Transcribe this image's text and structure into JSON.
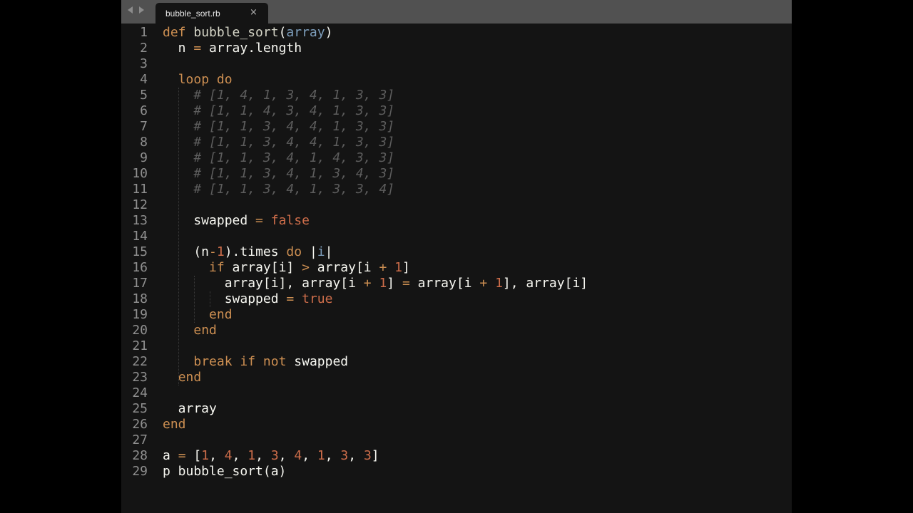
{
  "window": {
    "tabs": [
      {
        "label": "bubble_sort.rb",
        "close_icon": "×",
        "active": true
      }
    ],
    "nav_icons": [
      "back-arrow-icon",
      "forward-arrow-icon"
    ]
  },
  "editor": {
    "language": "ruby",
    "lines": [
      {
        "n": "1",
        "tokens": [
          [
            "k",
            "def"
          ],
          [
            "t",
            " "
          ],
          [
            "fn",
            "bubble_sort"
          ],
          [
            "t",
            "("
          ],
          [
            "pa",
            "array"
          ],
          [
            "t",
            ")"
          ]
        ]
      },
      {
        "n": "2",
        "tokens": [
          [
            "t",
            "  n "
          ],
          [
            "op",
            "="
          ],
          [
            "t",
            " array.length"
          ]
        ]
      },
      {
        "n": "3",
        "tokens": []
      },
      {
        "n": "4",
        "tokens": [
          [
            "t",
            "  "
          ],
          [
            "k",
            "loop"
          ],
          [
            "t",
            " "
          ],
          [
            "k",
            "do"
          ]
        ]
      },
      {
        "n": "5",
        "tokens": [
          [
            "t",
            "    "
          ],
          [
            "c",
            "# [1, 4, 1, 3, 4, 1, 3, 3]"
          ]
        ]
      },
      {
        "n": "6",
        "tokens": [
          [
            "t",
            "    "
          ],
          [
            "c",
            "# [1, 1, 4, 3, 4, 1, 3, 3]"
          ]
        ]
      },
      {
        "n": "7",
        "tokens": [
          [
            "t",
            "    "
          ],
          [
            "c",
            "# [1, 1, 3, 4, 4, 1, 3, 3]"
          ]
        ]
      },
      {
        "n": "8",
        "tokens": [
          [
            "t",
            "    "
          ],
          [
            "c",
            "# [1, 1, 3, 4, 4, 1, 3, 3]"
          ]
        ]
      },
      {
        "n": "9",
        "tokens": [
          [
            "t",
            "    "
          ],
          [
            "c",
            "# [1, 1, 3, 4, 1, 4, 3, 3]"
          ]
        ]
      },
      {
        "n": "10",
        "tokens": [
          [
            "t",
            "    "
          ],
          [
            "c",
            "# [1, 1, 3, 4, 1, 3, 4, 3]"
          ]
        ]
      },
      {
        "n": "11",
        "tokens": [
          [
            "t",
            "    "
          ],
          [
            "c",
            "# [1, 1, 3, 4, 1, 3, 3, 4]"
          ]
        ]
      },
      {
        "n": "12",
        "tokens": []
      },
      {
        "n": "13",
        "tokens": [
          [
            "t",
            "    swapped "
          ],
          [
            "op",
            "="
          ],
          [
            "t",
            " "
          ],
          [
            "b",
            "false"
          ]
        ]
      },
      {
        "n": "14",
        "tokens": []
      },
      {
        "n": "15",
        "tokens": [
          [
            "t",
            "    (n"
          ],
          [
            "op",
            "-"
          ],
          [
            "n",
            "1"
          ],
          [
            "t",
            ").times "
          ],
          [
            "k",
            "do"
          ],
          [
            "t",
            " |"
          ],
          [
            "pa",
            "i"
          ],
          [
            "t",
            "|"
          ]
        ]
      },
      {
        "n": "16",
        "tokens": [
          [
            "t",
            "      "
          ],
          [
            "k",
            "if"
          ],
          [
            "t",
            " array[i] "
          ],
          [
            "op",
            ">"
          ],
          [
            "t",
            " array[i "
          ],
          [
            "op",
            "+"
          ],
          [
            "t",
            " "
          ],
          [
            "n",
            "1"
          ],
          [
            "t",
            "]"
          ]
        ]
      },
      {
        "n": "17",
        "tokens": [
          [
            "t",
            "        array[i], array[i "
          ],
          [
            "op",
            "+"
          ],
          [
            "t",
            " "
          ],
          [
            "n",
            "1"
          ],
          [
            "t",
            "] "
          ],
          [
            "op",
            "="
          ],
          [
            "t",
            " array[i "
          ],
          [
            "op",
            "+"
          ],
          [
            "t",
            " "
          ],
          [
            "n",
            "1"
          ],
          [
            "t",
            "], array[i]"
          ]
        ]
      },
      {
        "n": "18",
        "tokens": [
          [
            "t",
            "        swapped "
          ],
          [
            "op",
            "="
          ],
          [
            "t",
            " "
          ],
          [
            "b",
            "true"
          ]
        ]
      },
      {
        "n": "19",
        "tokens": [
          [
            "t",
            "      "
          ],
          [
            "k",
            "end"
          ]
        ]
      },
      {
        "n": "20",
        "tokens": [
          [
            "t",
            "    "
          ],
          [
            "k",
            "end"
          ]
        ]
      },
      {
        "n": "21",
        "tokens": []
      },
      {
        "n": "22",
        "tokens": [
          [
            "t",
            "    "
          ],
          [
            "k",
            "break"
          ],
          [
            "t",
            " "
          ],
          [
            "k",
            "if"
          ],
          [
            "t",
            " "
          ],
          [
            "k",
            "not"
          ],
          [
            "t",
            " swapped"
          ]
        ]
      },
      {
        "n": "23",
        "tokens": [
          [
            "t",
            "  "
          ],
          [
            "k",
            "end"
          ]
        ]
      },
      {
        "n": "24",
        "tokens": []
      },
      {
        "n": "25",
        "tokens": [
          [
            "t",
            "  array"
          ]
        ]
      },
      {
        "n": "26",
        "tokens": [
          [
            "k",
            "end"
          ]
        ]
      },
      {
        "n": "27",
        "tokens": []
      },
      {
        "n": "28",
        "tokens": [
          [
            "t",
            "a "
          ],
          [
            "op",
            "="
          ],
          [
            "t",
            " ["
          ],
          [
            "n",
            "1"
          ],
          [
            "t",
            ", "
          ],
          [
            "n",
            "4"
          ],
          [
            "t",
            ", "
          ],
          [
            "n",
            "1"
          ],
          [
            "t",
            ", "
          ],
          [
            "n",
            "3"
          ],
          [
            "t",
            ", "
          ],
          [
            "n",
            "4"
          ],
          [
            "t",
            ", "
          ],
          [
            "n",
            "1"
          ],
          [
            "t",
            ", "
          ],
          [
            "n",
            "3"
          ],
          [
            "t",
            ", "
          ],
          [
            "n",
            "3"
          ],
          [
            "t",
            "]"
          ]
        ]
      },
      {
        "n": "29",
        "tokens": [
          [
            "t",
            "p bubble_sort(a)"
          ]
        ]
      }
    ]
  }
}
